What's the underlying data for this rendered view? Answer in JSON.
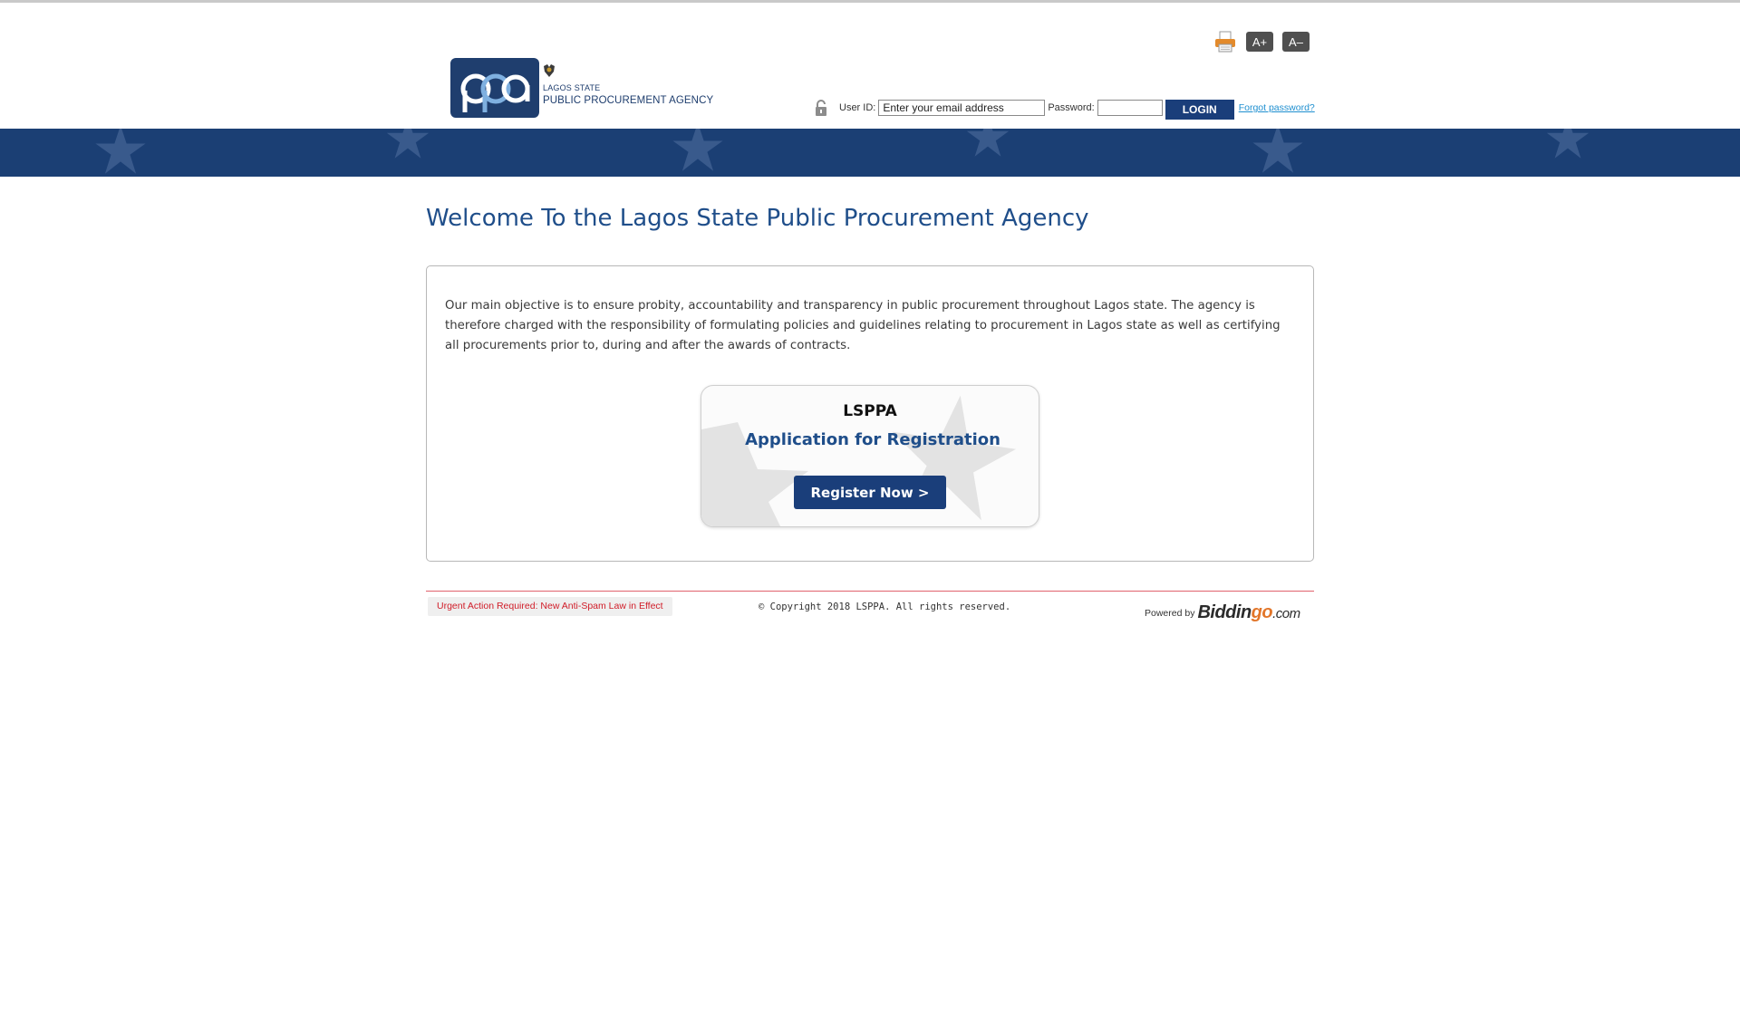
{
  "header": {
    "logo_monogram": "ppa",
    "logo_line1": "LAGOS STATE",
    "logo_line2": "PUBLIC PROCUREMENT AGENCY",
    "tools": {
      "print_icon": "printer-icon",
      "font_increase_label": "A+",
      "font_decrease_label": "A–"
    },
    "login": {
      "lock_icon": "lock-icon",
      "user_label": "User ID:",
      "user_placeholder": "Enter your email address",
      "user_value": "",
      "password_label": "Password:",
      "password_value": "",
      "login_label": "LOGIN",
      "forgot_label": "Forgot password?"
    }
  },
  "banner": {
    "color": "#1b3f74",
    "star_color": "#3f5f91"
  },
  "main": {
    "title": "Welcome To the Lagos State Public Procurement Agency",
    "intro": "Our main objective is to ensure probity, accountability and transparency in public procurement throughout Lagos state. The agency is therefore charged with the responsibility of formulating policies and guidelines relating to procurement in Lagos state as well as certifying all procurements prior to, during and after the awards of contracts.",
    "registration": {
      "title": "LSPPA",
      "subtitle": "Application for Registration",
      "button_label": "Register Now >"
    }
  },
  "footer": {
    "urgent_label": "Urgent Action Required: New Anti-Spam Law in Effect",
    "copyright": "© Copyright 2018 LSPPA. All rights reserved.",
    "powered_label": "Powered by",
    "brand_part1": "Biddin",
    "brand_part2": "go",
    "brand_part3": ".com"
  },
  "colors": {
    "accent": "#1a3e7a",
    "title": "#1f4e8a",
    "urgent": "#d01c28",
    "link": "#1e8fd0"
  }
}
